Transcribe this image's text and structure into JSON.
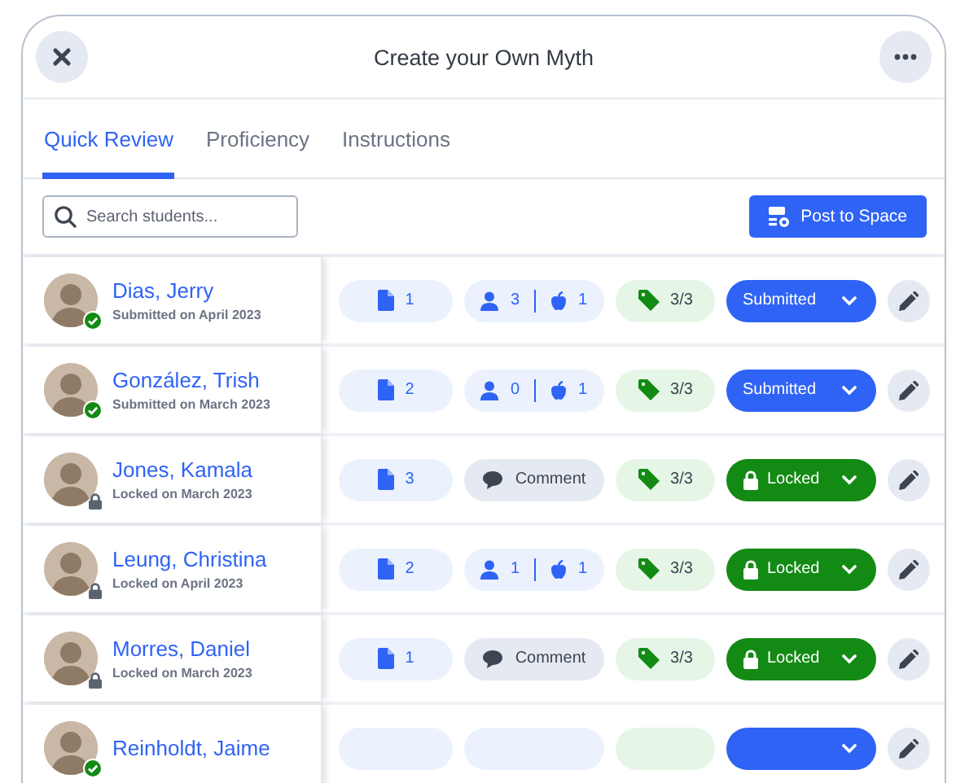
{
  "header": {
    "title": "Create your Own Myth"
  },
  "tabs": [
    {
      "label": "Quick Review",
      "selected": true
    },
    {
      "label": "Proficiency",
      "selected": false
    },
    {
      "label": "Instructions",
      "selected": false
    }
  ],
  "search": {
    "placeholder": "Search students..."
  },
  "post_button": {
    "label": "Post to Space"
  },
  "students": [
    {
      "name": "Dias, Jerry",
      "note": "Submitted on April 2023",
      "files": "1",
      "activity": {
        "kind": "counts",
        "people": "3",
        "apples": "1"
      },
      "tags": "3/3",
      "status": {
        "kind": "submitted",
        "label": "Submitted"
      }
    },
    {
      "name": "González, Trish",
      "note": "Submitted on March 2023",
      "files": "2",
      "activity": {
        "kind": "counts",
        "people": "0",
        "apples": "1"
      },
      "tags": "3/3",
      "status": {
        "kind": "submitted",
        "label": "Submitted"
      }
    },
    {
      "name": "Jones, Kamala",
      "note": "Locked on March 2023",
      "files": "3",
      "activity": {
        "kind": "comment",
        "label": "Comment"
      },
      "tags": "3/3",
      "status": {
        "kind": "locked",
        "label": "Locked"
      }
    },
    {
      "name": "Leung, Christina",
      "note": "Locked on April 2023",
      "files": "2",
      "activity": {
        "kind": "counts",
        "people": "1",
        "apples": "1"
      },
      "tags": "3/3",
      "status": {
        "kind": "locked",
        "label": "Locked"
      }
    },
    {
      "name": "Morres, Daniel",
      "note": "Locked on March 2023",
      "files": "1",
      "activity": {
        "kind": "comment",
        "label": "Comment"
      },
      "tags": "3/3",
      "status": {
        "kind": "locked",
        "label": "Locked"
      }
    },
    {
      "name": "Reinholdt, Jaime",
      "status": {
        "kind": "submitted"
      }
    }
  ]
}
